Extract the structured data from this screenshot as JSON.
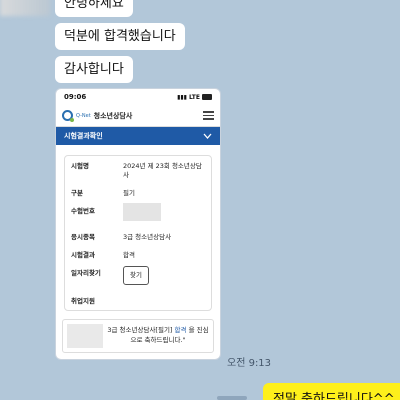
{
  "chat": {
    "incoming": [
      "안녕하세요",
      "덕분에 합격했습니다",
      "감사합니다"
    ],
    "time": "오전 9:13",
    "outgoing": "정말 축하드립니다^^"
  },
  "screenshot": {
    "clock": "09:06",
    "network": "LTE",
    "battery": "95",
    "logo_text": "Q-Net",
    "app_title": "청소년상담사",
    "nav_label": "시험결과확인",
    "nav_chevron": "chevron-down-icon",
    "rows": [
      {
        "key": "시험명",
        "value": "2024년 제 23회 청소년상담사"
      },
      {
        "key": "구분",
        "value": "필기"
      },
      {
        "key": "수험번호",
        "value": ""
      },
      {
        "key": "응시종목",
        "value": "3급 청소년상담사"
      },
      {
        "key": "시험결과",
        "value": "합격"
      },
      {
        "key": "일자리찾기",
        "value": "찾기"
      },
      {
        "key": "취업지원",
        "value": ""
      }
    ],
    "message_prefix": "3급 청소년상담사[필기]",
    "message_highlight": "합격",
    "message_suffix": "을 진심으로 축하드립니다.\""
  },
  "colors": {
    "chat_bg": "#b2c7d9",
    "my_bubble": "#fef01b",
    "nav_blue": "#1f5aa6"
  }
}
